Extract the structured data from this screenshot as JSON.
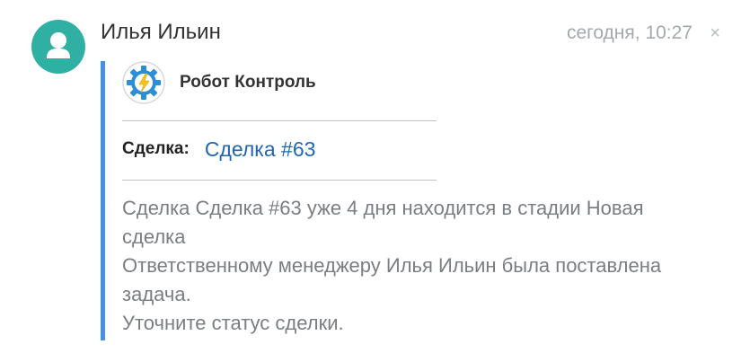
{
  "author": {
    "name": "Илья Ильин",
    "avatar_icon": "user-silhouette-icon",
    "avatar_color": "#2fb0a3"
  },
  "timestamp": "сегодня, 10:27",
  "close_icon": "×",
  "card": {
    "accent_color": "#4a90e2",
    "sender": {
      "icon": "robot-gear-lightning-icon",
      "name": "Робот Контроль"
    },
    "field": {
      "label": "Сделка:",
      "value": "Сделка #63",
      "link_color": "#2067b0"
    },
    "body_lines": [
      "Сделка Сделка #63 уже 4 дня находится в стадии Новая",
      "сделка",
      "Ответственному менеджеру Илья Ильин была поставлена",
      "задача.",
      "Уточните статус сделки."
    ]
  }
}
